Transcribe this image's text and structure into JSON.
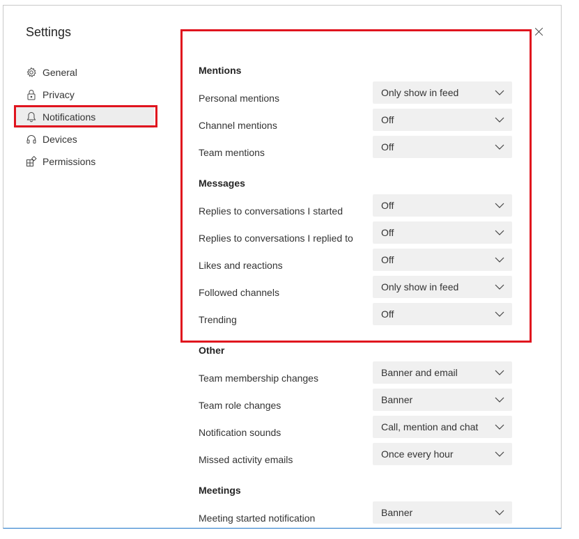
{
  "settings": {
    "title": "Settings",
    "nav": [
      {
        "label": "General",
        "icon": "gear-icon"
      },
      {
        "label": "Privacy",
        "icon": "lock-icon"
      },
      {
        "label": "Notifications",
        "icon": "bell-icon"
      },
      {
        "label": "Devices",
        "icon": "headset-icon"
      },
      {
        "label": "Permissions",
        "icon": "grid-icon"
      }
    ],
    "active_nav": "Notifications"
  },
  "sections": {
    "mentions": {
      "title": "Mentions",
      "rows": [
        {
          "label": "Personal mentions",
          "value": "Only show in feed"
        },
        {
          "label": "Channel mentions",
          "value": "Off"
        },
        {
          "label": "Team mentions",
          "value": "Off"
        }
      ]
    },
    "messages": {
      "title": "Messages",
      "rows": [
        {
          "label": "Replies to conversations I started",
          "value": "Off"
        },
        {
          "label": "Replies to conversations I replied to",
          "value": "Off"
        },
        {
          "label": "Likes and reactions",
          "value": "Off"
        },
        {
          "label": "Followed channels",
          "value": "Only show in feed"
        },
        {
          "label": "Trending",
          "value": "Off"
        }
      ]
    },
    "other": {
      "title": "Other",
      "rows": [
        {
          "label": "Team membership changes",
          "value": "Banner and email"
        },
        {
          "label": "Team role changes",
          "value": "Banner"
        },
        {
          "label": "Notification sounds",
          "value": "Call, mention and chat"
        },
        {
          "label": "Missed activity emails",
          "value": "Once every hour"
        }
      ]
    },
    "meetings": {
      "title": "Meetings",
      "rows": [
        {
          "label": "Meeting started notification",
          "value": "Banner"
        }
      ]
    }
  },
  "colors": {
    "highlight": "#e0141e",
    "dropdown_bg": "#f0f0f0",
    "active_nav_bg": "#ededed"
  }
}
